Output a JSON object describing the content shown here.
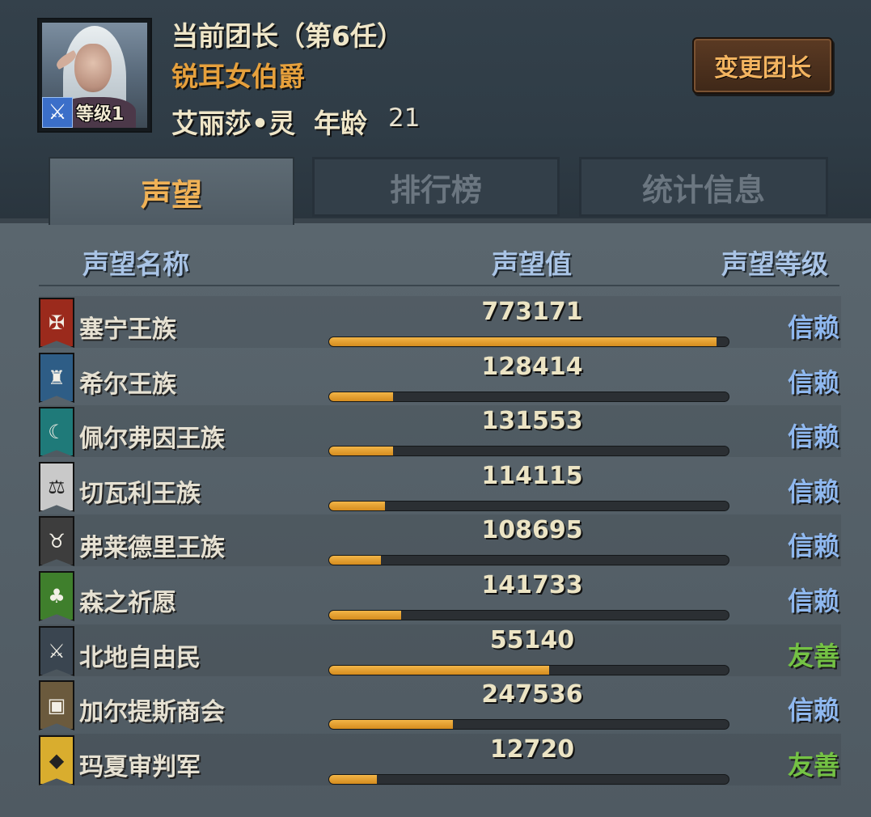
{
  "leader": {
    "title": "当前团长（第6任）",
    "rank": "锐耳女伯爵",
    "name": "艾丽莎•灵",
    "age_label": "年龄",
    "age": "21",
    "level": "等级1"
  },
  "buttons": {
    "change_leader": "变更团长"
  },
  "tabs": [
    {
      "label": "声望",
      "active": true
    },
    {
      "label": "排行榜",
      "active": false
    },
    {
      "label": "统计信息",
      "active": false
    }
  ],
  "columns": {
    "name": "声望名称",
    "value": "声望值",
    "level": "声望等级"
  },
  "colors": {
    "trust": "#8fb8ef",
    "friendly": "#74c244",
    "bar_fill": "#e8a533",
    "accent": "#f0b256"
  },
  "factions": [
    {
      "name": "塞宁王族",
      "value": "773171",
      "progress": 0.97,
      "level": "信赖",
      "icon": "sword-cross-icon",
      "banner_color": "#9b2a1c"
    },
    {
      "name": "希尔王族",
      "value": "128414",
      "progress": 0.16,
      "level": "信赖",
      "icon": "castle-icon",
      "banner_color": "#2e5d86"
    },
    {
      "name": "佩尔弗因王族",
      "value": "131553",
      "progress": 0.16,
      "level": "信赖",
      "icon": "crescent-moon-icon",
      "banner_color": "#1f7a79"
    },
    {
      "name": "切瓦利王族",
      "value": "114115",
      "progress": 0.14,
      "level": "信赖",
      "icon": "scales-icon",
      "banner_color": "#c9c9c9"
    },
    {
      "name": "弗莱德里王族",
      "value": "108695",
      "progress": 0.13,
      "level": "信赖",
      "icon": "beast-head-icon",
      "banner_color": "#3d3d3d"
    },
    {
      "name": "森之祈愿",
      "value": "141733",
      "progress": 0.18,
      "level": "信赖",
      "icon": "tree-icon",
      "banner_color": "#3f7f2c"
    },
    {
      "name": "北地自由民",
      "value": "55140",
      "progress": 0.55,
      "level": "友善",
      "icon": "crossed-axes-icon",
      "banner_color": "#3a4550"
    },
    {
      "name": "加尔提斯商会",
      "value": "247536",
      "progress": 0.31,
      "level": "信赖",
      "icon": "treasure-chest-icon",
      "banner_color": "#6b5a3d"
    },
    {
      "name": "玛夏审判军",
      "value": "12720",
      "progress": 0.12,
      "level": "友善",
      "icon": "diamond-sigil-icon",
      "banner_color": "#d9ad2e"
    }
  ]
}
